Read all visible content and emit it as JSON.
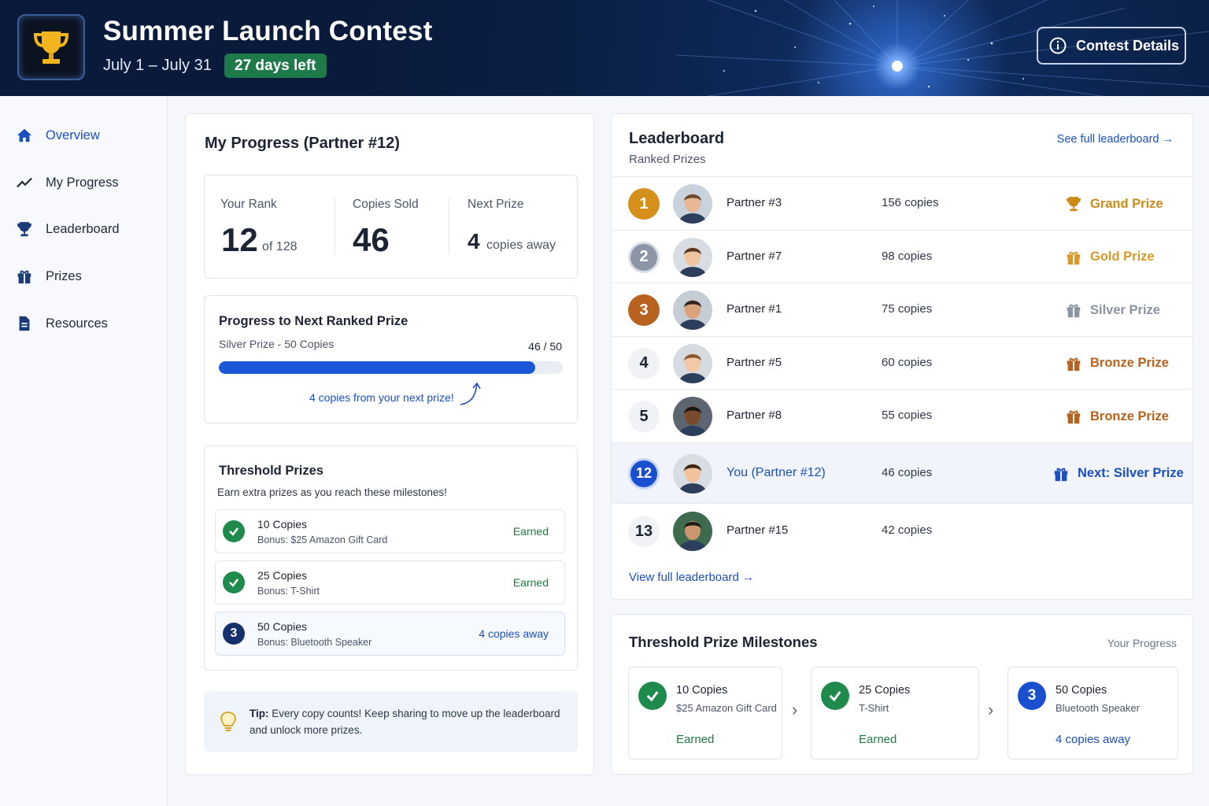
{
  "header": {
    "title": "Summer Launch Contest",
    "dates": "July 1 – July 31",
    "days_left": "27 days left",
    "details_button": "Contest Details"
  },
  "sidebar": {
    "items": [
      {
        "label": "Overview",
        "icon": "home-icon",
        "active": true
      },
      {
        "label": "My Progress",
        "icon": "trend-icon"
      },
      {
        "label": "Leaderboard",
        "icon": "trophy-icon"
      },
      {
        "label": "Prizes",
        "icon": "gift-icon"
      },
      {
        "label": "Resources",
        "icon": "document-icon"
      }
    ]
  },
  "progress": {
    "title": "My Progress (Partner #12)",
    "rank_label": "Your Rank",
    "rank_value": "12",
    "rank_of": "of 128",
    "sold_label": "Copies Sold",
    "sold_value": "46",
    "next_label": "Next Prize",
    "next_value": "4",
    "next_unit": "copies away",
    "ranked": {
      "title": "Progress to Next Ranked Prize",
      "subtitle": "Silver Prize - 50 Copies",
      "count": "46 / 50",
      "fraction": 0.92,
      "note": "4 copies from your next prize!"
    },
    "threshold": {
      "title": "Threshold Prizes",
      "subtitle": "Earn extra prizes as you reach these milestones!",
      "items": [
        {
          "name": "10 Copies",
          "bonus": "Bonus: $25 Amazon Gift Card",
          "status": "Earned"
        },
        {
          "name": "25 Copies",
          "bonus": "Bonus: T-Shirt",
          "status": "Earned"
        },
        {
          "name": "50 Copies",
          "bonus": "Bonus: Bluetooth Speaker",
          "status": "4 copies away",
          "number": "3"
        }
      ]
    },
    "tip": {
      "bold": "Tip:",
      "text": " Every copy counts! Keep sharing to move up the leaderboard and unlock more prizes."
    }
  },
  "leaderboard": {
    "title": "Leaderboard",
    "subtitle": "Ranked Prizes",
    "see_full": "See full leaderboard",
    "view_full": "View full leaderboard",
    "rows": [
      {
        "rank": "1",
        "name": "Partner #3",
        "copies": "156 copies",
        "prize": "Grand Prize"
      },
      {
        "rank": "2",
        "name": "Partner #7",
        "copies": "98 copies",
        "prize": "Gold Prize"
      },
      {
        "rank": "3",
        "name": "Partner #1",
        "copies": "75 copies",
        "prize": "Silver Prize"
      },
      {
        "rank": "4",
        "name": "Partner #5",
        "copies": "60 copies",
        "prize": "Bronze Prize"
      },
      {
        "rank": "5",
        "name": "Partner #8",
        "copies": "55 copies",
        "prize": "Bronze Prize"
      },
      {
        "rank": "12",
        "name": "You (Partner #12)",
        "copies": "46 copies",
        "prize": "Next: Silver Prize"
      },
      {
        "rank": "13",
        "name": "Partner #15",
        "copies": "42 copies",
        "prize": ""
      }
    ]
  },
  "milestones": {
    "title": "Threshold Prize Milestones",
    "subtitle": "Your Progress",
    "items": [
      {
        "name": "10 Copies",
        "bonus": "$25 Amazon Gift Card",
        "status": "Earned"
      },
      {
        "name": "25 Copies",
        "bonus": "T-Shirt",
        "status": "Earned"
      },
      {
        "name": "50 Copies",
        "bonus": "Bluetooth Speaker",
        "status": "4 copies away",
        "number": "3"
      }
    ]
  },
  "colors": {
    "accent": "#1a4fbf",
    "success": "#1e8a4c",
    "gold": "#d5901b",
    "bronze": "#b8621f",
    "header_bg": "#0a1f44"
  }
}
